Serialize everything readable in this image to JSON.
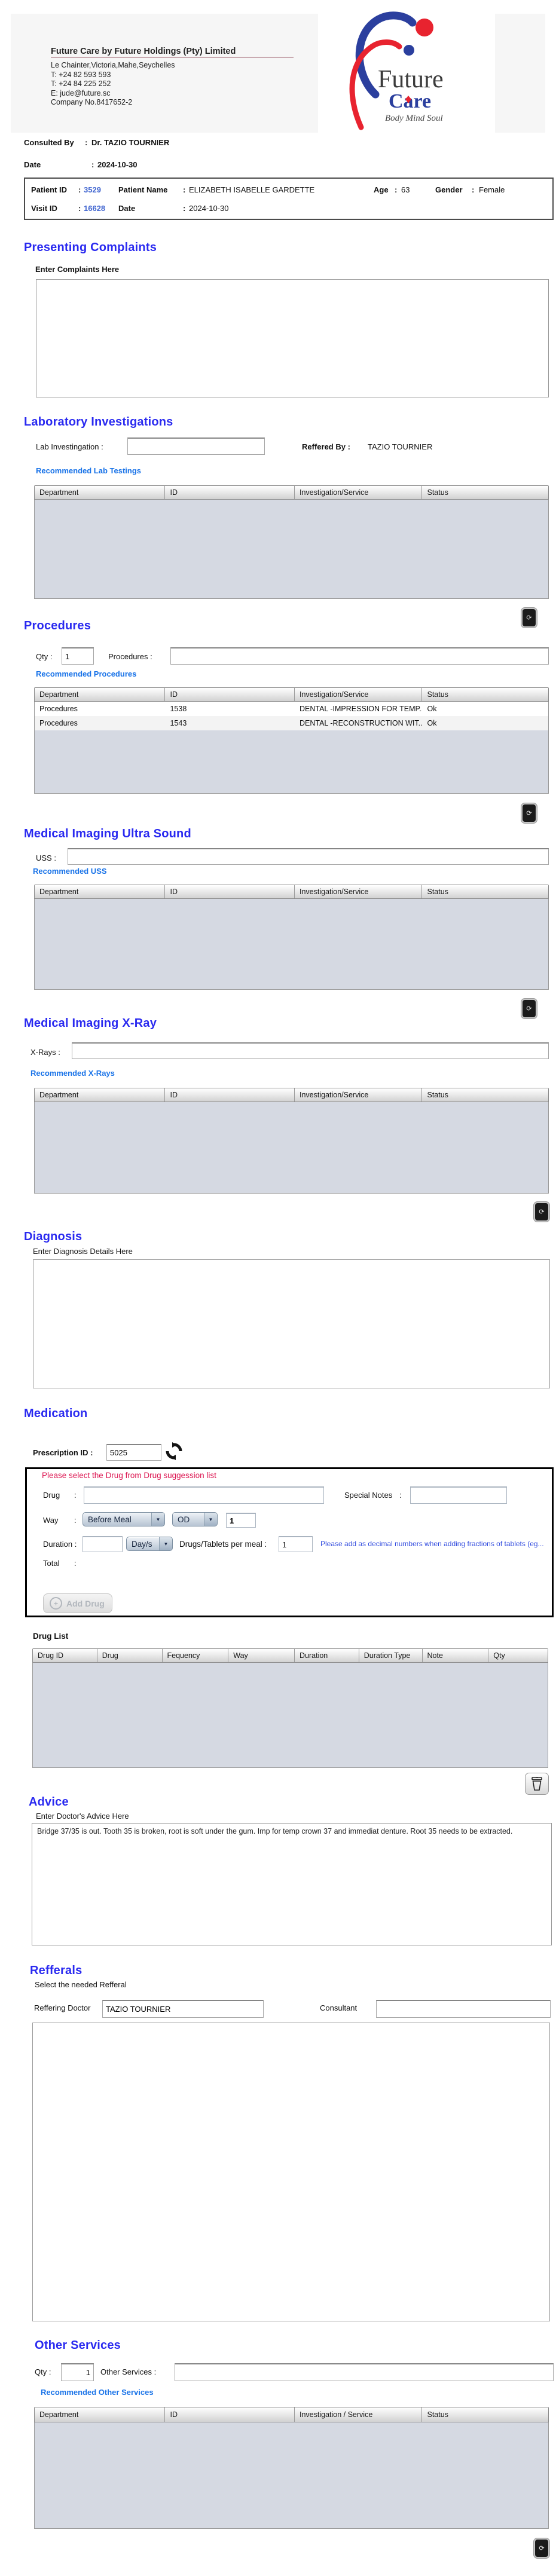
{
  "misc": {
    "colon": ":"
  },
  "header": {
    "company_name": "Future Care by Future Holdings (Pty) Limited",
    "address": "Le Chainter,Victoria,Mahe,Seychelles",
    "phone1": "T: +24  82 593 593",
    "phone2": "T: +24  84 225 252",
    "email": "E: jude@future.sc",
    "company_no": "Company No.8417652-2",
    "logo_word1": "Future",
    "logo_word2": "Care",
    "logo_tagline": "Body Mind Soul"
  },
  "consult": {
    "consulted_by_label": "Consulted By",
    "consulted_by_value": "Dr.  TAZIO TOURNIER",
    "date_label": "Date",
    "date_value": "2024-10-30"
  },
  "patient": {
    "patient_id_label": "Patient ID",
    "patient_id": "3529",
    "patient_name_label": "Patient Name",
    "patient_name": "ELIZABETH ISABELLE GARDETTE",
    "age_label": "Age",
    "age": "63",
    "gender_label": "Gender",
    "gender": "Female",
    "visit_id_label": "Visit ID",
    "visit_id": "16628",
    "visit_date_label": "Date",
    "visit_date": "2024-10-30"
  },
  "complaints": {
    "title": "Presenting Complaints",
    "label": "Enter Complaints Here",
    "value": ""
  },
  "lab": {
    "title": "Laboratory  Investigations",
    "input_label": "Lab Investingation :",
    "input_value": "",
    "referred_label": "Reffered By :",
    "referred_value": "TAZIO TOURNIER",
    "link": "Recommended Lab Testings",
    "headers": [
      "Department",
      "ID",
      "Investigation/Service",
      "Status"
    ]
  },
  "procedures": {
    "title": "Procedures",
    "qty_label": "Qty :",
    "qty": "1",
    "input_label": "Procedures :",
    "input_value": "",
    "link": "Recommended Procedures",
    "headers": [
      "Department",
      "ID",
      "Investigation/Service",
      "Status"
    ],
    "rows": [
      [
        "Procedures",
        "1538",
        "DENTAL -IMPRESSION FOR TEMP...",
        "Ok"
      ],
      [
        "Procedures",
        "1543",
        "DENTAL -RECONSTRUCTION WIT...",
        "Ok"
      ]
    ]
  },
  "uss": {
    "title": "Medical Imaging Ultra Sound",
    "input_label": "USS :",
    "input_value": "",
    "link": "Recommended USS",
    "headers": [
      "Department",
      "ID",
      "Investigation/Service",
      "Status"
    ]
  },
  "xray": {
    "title": "Medical Imaging X-Ray",
    "input_label": "X-Rays :",
    "input_value": "",
    "link": "Recommended X-Rays",
    "headers": [
      "Department",
      "ID",
      "Investigation/Service",
      "Status"
    ]
  },
  "diagnosis": {
    "title": "Diagnosis",
    "label": "Enter Diagnosis Details Here",
    "value": ""
  },
  "medication": {
    "title": "Medication",
    "prescription_label": "Prescription ID :",
    "prescription_id": "5025",
    "warning": "Please select the Drug from Drug suggession list",
    "drug_label": "Drug",
    "drug_value": "",
    "special_notes_label": "Special Notes",
    "special_notes_value": "",
    "way_label": "Way",
    "way_option": "Before Meal",
    "freq_option": "OD",
    "way_qty": "1",
    "duration_label": "Duration :",
    "duration_value": "",
    "duration_unit": "Day/s",
    "tablets_label": "Drugs/Tablets per meal :",
    "tablets_value": "1",
    "note": "Please add as decimal numbers when adding fractions of tablets (eg...",
    "total_label": "Total",
    "add_drug_label": "Add Drug",
    "drug_list_label": "Drug List",
    "drug_headers": [
      "Drug ID",
      "Drug",
      "Fequency",
      "Way",
      "Duration",
      "Duration Type",
      "Note",
      "Qty"
    ]
  },
  "advice": {
    "title": "Advice",
    "label": "Enter Doctor's Advice Here",
    "value": "Bridge 37/35 is out. Tooth 35 is broken, root is soft under the gum. Imp for temp crown 37 and immediat denture. Root 35 needs to be extracted."
  },
  "refferals": {
    "title": "Refferals",
    "label": "Select the needed Refferal",
    "doctor_label": "Reffering Doctor",
    "doctor_value": "TAZIO TOURNIER",
    "consultant_label": "Consultant",
    "consultant_value": ""
  },
  "other": {
    "title": "Other Services",
    "qty_label": "Qty :",
    "qty": "1",
    "input_label": "Other Services :",
    "input_value": "",
    "link": "Recommended Other Services",
    "headers": [
      "Department",
      "ID",
      "Investigation / Service",
      "Status"
    ]
  }
}
